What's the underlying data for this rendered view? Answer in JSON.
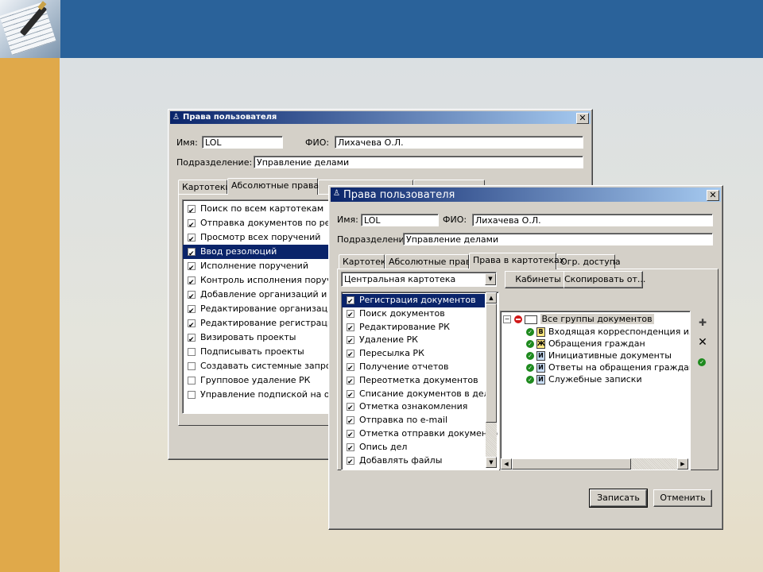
{
  "window_title": "Права пользователя",
  "back_dialog": {
    "name_label": "Имя:",
    "name_value": "LOL",
    "fio_label": "ФИО:",
    "fio_value": "Лихачева О.Л.",
    "dept_label": "Подразделение:",
    "dept_value": "Управление делами",
    "tabs": [
      {
        "label": "Картотеки"
      },
      {
        "label": "Абсолютные права"
      }
    ],
    "rights": [
      {
        "label": "Поиск по всем картотекам",
        "checked": true,
        "selected": false
      },
      {
        "label": "Отправка документов по реес",
        "checked": true,
        "selected": false
      },
      {
        "label": "Просмотр всех поручений",
        "checked": true,
        "selected": false
      },
      {
        "label": "Ввод резолюций",
        "checked": true,
        "selected": true
      },
      {
        "label": "Исполнение поручений",
        "checked": true,
        "selected": false
      },
      {
        "label": "Контроль исполнения поручен",
        "checked": true,
        "selected": false
      },
      {
        "label": "Добавление организаций и гр",
        "checked": true,
        "selected": false
      },
      {
        "label": "Редактирование организаций",
        "checked": true,
        "selected": false
      },
      {
        "label": "Редактирование регистрацио",
        "checked": true,
        "selected": false
      },
      {
        "label": "Визировать проекты",
        "checked": true,
        "selected": false
      },
      {
        "label": "Подписывать проекты",
        "checked": false,
        "selected": false
      },
      {
        "label": "Создавать системные запрос",
        "checked": false,
        "selected": false
      },
      {
        "label": "Групповое удаление РК",
        "checked": false,
        "selected": false
      },
      {
        "label": "Управление подпиской на опо",
        "checked": false,
        "selected": false
      }
    ]
  },
  "front_dialog": {
    "name_label": "Имя:",
    "name_value": "LOL",
    "fio_label": "ФИО:",
    "fio_value": "Лихачева О.Л.",
    "dept_label": "Подразделение:",
    "dept_value": "Управление делами",
    "tabs": [
      {
        "label": "Картотеки"
      },
      {
        "label": "Абсолютные права"
      },
      {
        "label": "Права в картотеках"
      },
      {
        "label": "Огр. доступа"
      }
    ],
    "kartoteka_select": "Центральная картотека",
    "cabinets_button": "Кабинеты",
    "copy_button": "Скопировать от...",
    "rights": [
      {
        "label": "Регистрация документов",
        "checked": true,
        "selected": true
      },
      {
        "label": "Поиск документов",
        "checked": true,
        "selected": false
      },
      {
        "label": "Редактирование РК",
        "checked": true,
        "selected": false
      },
      {
        "label": "Удаление РК",
        "checked": true,
        "selected": false
      },
      {
        "label": "Пересылка РК",
        "checked": true,
        "selected": false
      },
      {
        "label": "Получение отчетов",
        "checked": true,
        "selected": false
      },
      {
        "label": "Переотметка документов",
        "checked": true,
        "selected": false
      },
      {
        "label": "Списание документов в дело",
        "checked": true,
        "selected": false
      },
      {
        "label": "Отметка ознакомления",
        "checked": true,
        "selected": false
      },
      {
        "label": "Отправка по e-mail",
        "checked": true,
        "selected": false
      },
      {
        "label": "Отметка отправки документов",
        "checked": true,
        "selected": false
      },
      {
        "label": "Опись дел",
        "checked": true,
        "selected": false
      },
      {
        "label": "Добавлять файлы",
        "checked": true,
        "selected": false
      }
    ],
    "tree_root": "Все группы документов",
    "tree_items": [
      {
        "badge": "В",
        "label": "Входящая корреспонденция из ра",
        "color": "yellow"
      },
      {
        "badge": "Ж",
        "label": "Обращения граждан",
        "color": "yellow"
      },
      {
        "badge": "И",
        "label": "Инициативные документы",
        "color": "blue"
      },
      {
        "badge": "И",
        "label": "Ответы на обращения граждан",
        "color": "blue"
      },
      {
        "badge": "И",
        "label": "Служебные записки",
        "color": "blue"
      }
    ],
    "save_button": "Записать",
    "cancel_button": "Отменить"
  },
  "colors": {
    "title_active": "#0a246a",
    "selection": "#0a246a",
    "header_bar": "#2a629a",
    "left_bar": "#e0a94a"
  }
}
